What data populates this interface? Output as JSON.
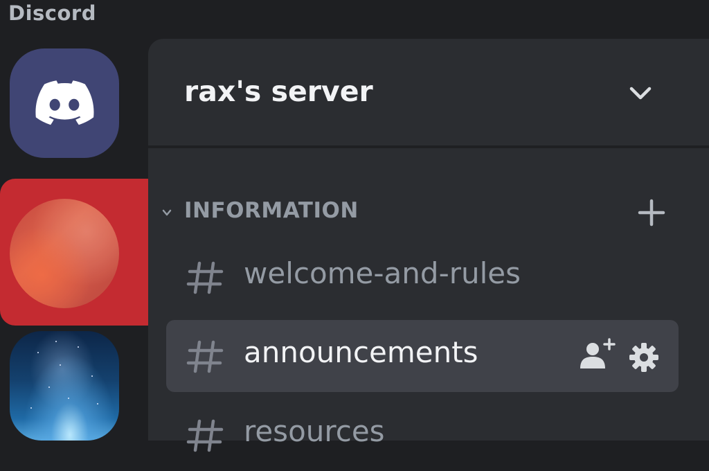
{
  "app": {
    "title": "Discord"
  },
  "servers": [
    {
      "name": "home",
      "icon": "discord-logo"
    },
    {
      "name": "server-nebula",
      "icon": "nebula-image",
      "selected": true
    },
    {
      "name": "server-sky",
      "icon": "night-sky-image"
    }
  ],
  "server": {
    "name": "rax's server",
    "menu_icon": "chevron-down-icon"
  },
  "category": {
    "label": "INFORMATION",
    "add_icon": "plus-icon"
  },
  "channels": [
    {
      "label": "welcome-and-rules",
      "icon": "hash-icon"
    },
    {
      "label": "announcements",
      "icon": "hash-icon",
      "active": true
    },
    {
      "label": "resources",
      "icon": "hash-icon"
    }
  ],
  "colors": {
    "background": "#1e1f22",
    "panel": "#2b2d31",
    "active_channel": "#404249",
    "highlight": "#c42b31",
    "blurple": "#404574",
    "muted_text": "#949ba4",
    "bright_text": "#f2f3f5"
  }
}
